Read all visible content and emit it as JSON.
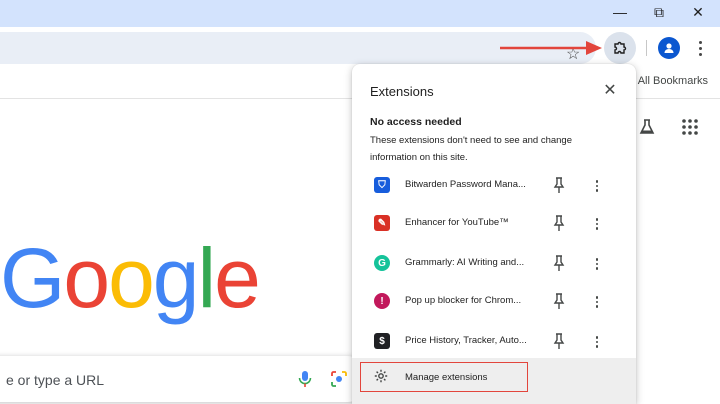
{
  "window": {
    "minimize_glyph": "—",
    "maximize_glyph": "⧉",
    "close_glyph": "✕"
  },
  "toolbar": {
    "bookmark_icon": "star-icon",
    "extensions_icon": "puzzle-icon",
    "profile_icon": "person-icon",
    "menu_icon": "kebab-icon"
  },
  "bookmarks_bar": {
    "all_bookmarks": "All Bookmarks"
  },
  "page": {
    "logo_letters": [
      "G",
      "o",
      "o",
      "g",
      "l",
      "e"
    ],
    "logo_colors": [
      "#4285F4",
      "#EA4335",
      "#FBBC05",
      "#4285F4",
      "#34A853",
      "#EA4335"
    ],
    "search_placeholder": "e or type a URL",
    "icons": [
      "labs-flask-icon",
      "apps-grid-icon",
      "mic-icon",
      "lens-icon"
    ]
  },
  "extensions_popup": {
    "title": "Extensions",
    "close_glyph": "✕",
    "section_title": "No access needed",
    "section_description": "These extensions don't need to see and change information on this site.",
    "items": [
      {
        "name": "Bitwarden Password Mana...",
        "icon_color": "#175ddc",
        "icon_glyph": "⛉"
      },
      {
        "name": "Enhancer for YouTube™",
        "icon_color": "#d93025",
        "icon_glyph": "✎"
      },
      {
        "name": "Grammarly: AI Writing and...",
        "icon_color": "#15c39a",
        "icon_glyph": "G"
      },
      {
        "name": "Pop up blocker for Chrom...",
        "icon_color": "#c2185b",
        "icon_glyph": "!"
      },
      {
        "name": "Price History, Tracker, Auto...",
        "icon_color": "#202124",
        "icon_glyph": "$"
      }
    ],
    "manage_label": "Manage extensions"
  },
  "annotation": {
    "arrow_color": "#e2453c",
    "highlight_color": "#e2453c"
  }
}
